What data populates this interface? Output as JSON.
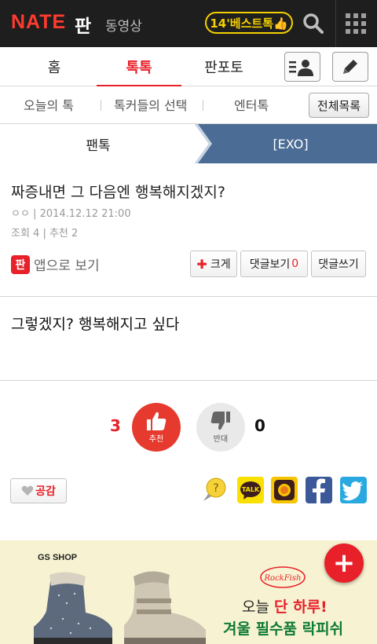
{
  "topbar": {
    "logo": "NATE",
    "logo_sub": "판",
    "video_link": "동영상",
    "best_button": "14'베스트톡👍"
  },
  "main_nav": {
    "tabs": [
      {
        "label": "홈"
      },
      {
        "label": "톡톡",
        "active": true
      },
      {
        "label": "판포토"
      }
    ]
  },
  "sub_nav": {
    "items": [
      "오늘의 톡",
      "톡커들의 선택",
      "엔터톡"
    ],
    "all_list_button": "전체목록"
  },
  "breadcrumb": {
    "left": "팬톡",
    "right": "[EXO]"
  },
  "article": {
    "title": "짜증내면 그 다음엔 행복해지겠지?",
    "meta": "ㅇㅇ | 2014.12.12 21:00",
    "stats": "조회 4 | 추천 2",
    "app_badge": "판",
    "app_view_label": "앱으로 보기",
    "buttons": {
      "bigger": "크게",
      "view_comments": "댓글보기",
      "comment_count": "0",
      "write_comment": "댓글쓰기"
    },
    "body": "그렇겠지? 행복해지고 싶다"
  },
  "vote": {
    "up_count": "3",
    "up_label": "추천",
    "down_label": "반대",
    "down_count": "0"
  },
  "empathy_button": "공감",
  "share_icons": [
    "comment-icon",
    "kakaotalk-icon",
    "kakaostory-icon",
    "facebook-icon",
    "twitter-icon"
  ],
  "ad": {
    "brand": "GS SHOP",
    "logo_text": "RockFish",
    "line1_pre": "오늘 ",
    "line1_em": "단 하루!",
    "line2": "겨울 필수품 락피쉬"
  },
  "colors": {
    "accent": "#e8202a",
    "topbar": "#1e1e1e",
    "breadcrumb": "#4a6c95",
    "best_yellow": "#f4d000"
  }
}
